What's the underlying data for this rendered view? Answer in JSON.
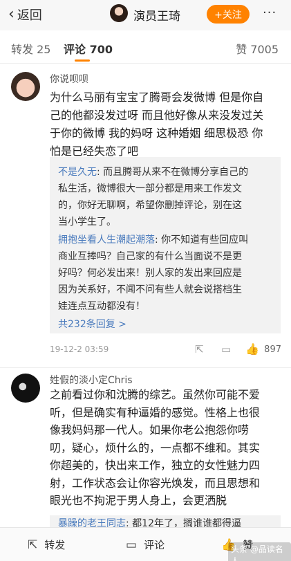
{
  "header": {
    "back_label": "返回",
    "title": "演员王琦",
    "follow_label": "+关注",
    "more_label": "···"
  },
  "tabs": {
    "repost": "转发 25",
    "comment": "评论 700",
    "like": "赞 7005"
  },
  "comments": [
    {
      "author": "你说呗呗",
      "lines": [
        "为什么马丽有宝宝了腾哥会发微博 但是你自",
        "己的他都没发过呀 而且他好像从来没发过关",
        "于你的微博 我的妈呀 这种婚姻 细思极恐 你",
        "怕是已经失恋了吧"
      ],
      "replies": [
        {
          "name": "不是久无",
          "lines": [
            ": 而且腾哥从来不在微博分享自己的",
            "私生活，微博很大一部分都是用来工作发文",
            "的，你好无聊啊，希望你删掉评论，别在这",
            "当小学生了。"
          ]
        },
        {
          "name": "拥抱坐看人生潮起潮落",
          "lines": [
            ": 你不知道有些回应叫",
            "商业互捧吗？自己家的有什么当面说不是更",
            "好吗？何必发出来！别人家的发出来回应是",
            "因为关系好，不闻不问有些人就会说搭档生",
            "娃连点互动都没有！"
          ]
        }
      ],
      "more_replies": "共232条回复 >",
      "time": "19-12-2 03:59",
      "likes": "897"
    },
    {
      "author": "姓假的淡小定Chris",
      "lines": [
        "之前看过你和沈腾的综艺。虽然你可能不爱",
        "听，但是确实有种逼婚的感觉。性格上也很",
        "像我妈妈那一代人。如果你老公抱怨你唠",
        "叨，疑心，烦什么的，一点都不维和。其实",
        "你超美的，快出来工作，独立的女性魅力四",
        "射，工作状态会让你容光焕发，而且思想和",
        "眼光也不拘泥于男人身上，会更洒脱"
      ],
      "reply_peek_name": "暴躁的老王同志",
      "reply_peek_text": ": 都12年了，搁谁谁都得逼"
    }
  ],
  "bottom_bar": {
    "repost": "转发",
    "comment": "评论",
    "like": "赞"
  },
  "watermark": "头条 @品读名人",
  "icons": {
    "back": "chevron-left-icon",
    "share": "share-icon",
    "comment": "comment-icon",
    "like": "thumbs-up-icon"
  },
  "colors": {
    "accent": "#ff8200",
    "link": "#4a7bbd"
  }
}
